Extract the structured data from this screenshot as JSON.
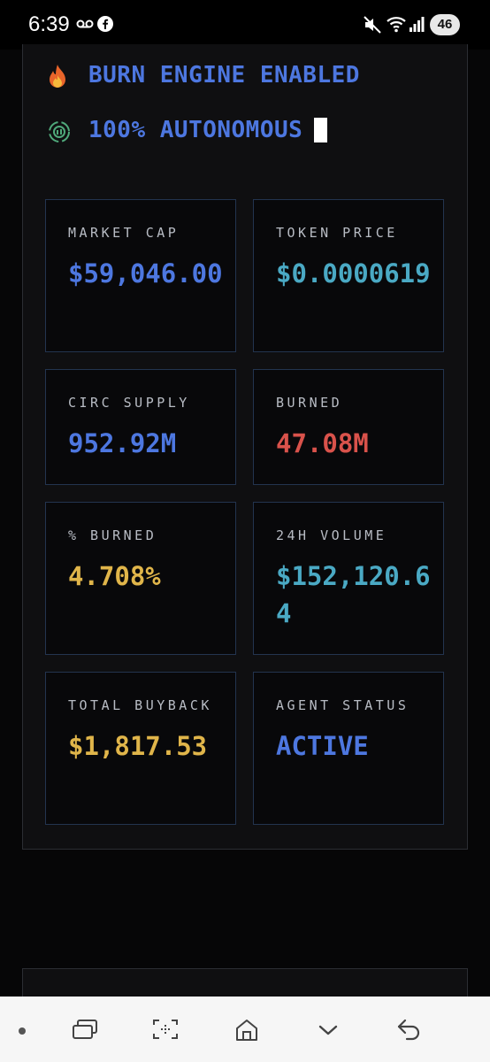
{
  "status_bar": {
    "time": "6:39",
    "battery": "46",
    "icons": [
      "voicemail-icon",
      "facebook-icon",
      "mute-icon",
      "wifi-icon",
      "signal-icon"
    ]
  },
  "headlines": {
    "burn": "BURN ENGINE ENABLED",
    "autonomous": "100% AUTONOMOUS"
  },
  "stats": {
    "market_cap": {
      "label": "MARKET CAP",
      "value": "$59,046.00"
    },
    "token_price": {
      "label": "TOKEN PRICE",
      "value": "$0.0000619"
    },
    "circ_supply": {
      "label": "CIRC SUPPLY",
      "value": "952.92M"
    },
    "burned": {
      "label": "BURNED",
      "value": "47.08M"
    },
    "pct_burned": {
      "label": "% BURNED",
      "value": "4.708%"
    },
    "volume_24h": {
      "label": "24H VOLUME",
      "value": "$152,120.64"
    },
    "total_buyback": {
      "label": "TOTAL BUYBACK",
      "value": "$1,817.53"
    },
    "agent_status": {
      "label": "AGENT STATUS",
      "value": "ACTIVE"
    }
  },
  "colors": {
    "blue": "#4d77e0",
    "cyan": "#4aa9c4",
    "red": "#d9524b",
    "yellow": "#e0b54a"
  },
  "nav_bar": {
    "icons": [
      "dot-icon",
      "recent-apps-icon",
      "screenshot-icon",
      "home-icon",
      "chevron-down-icon",
      "back-icon"
    ]
  }
}
